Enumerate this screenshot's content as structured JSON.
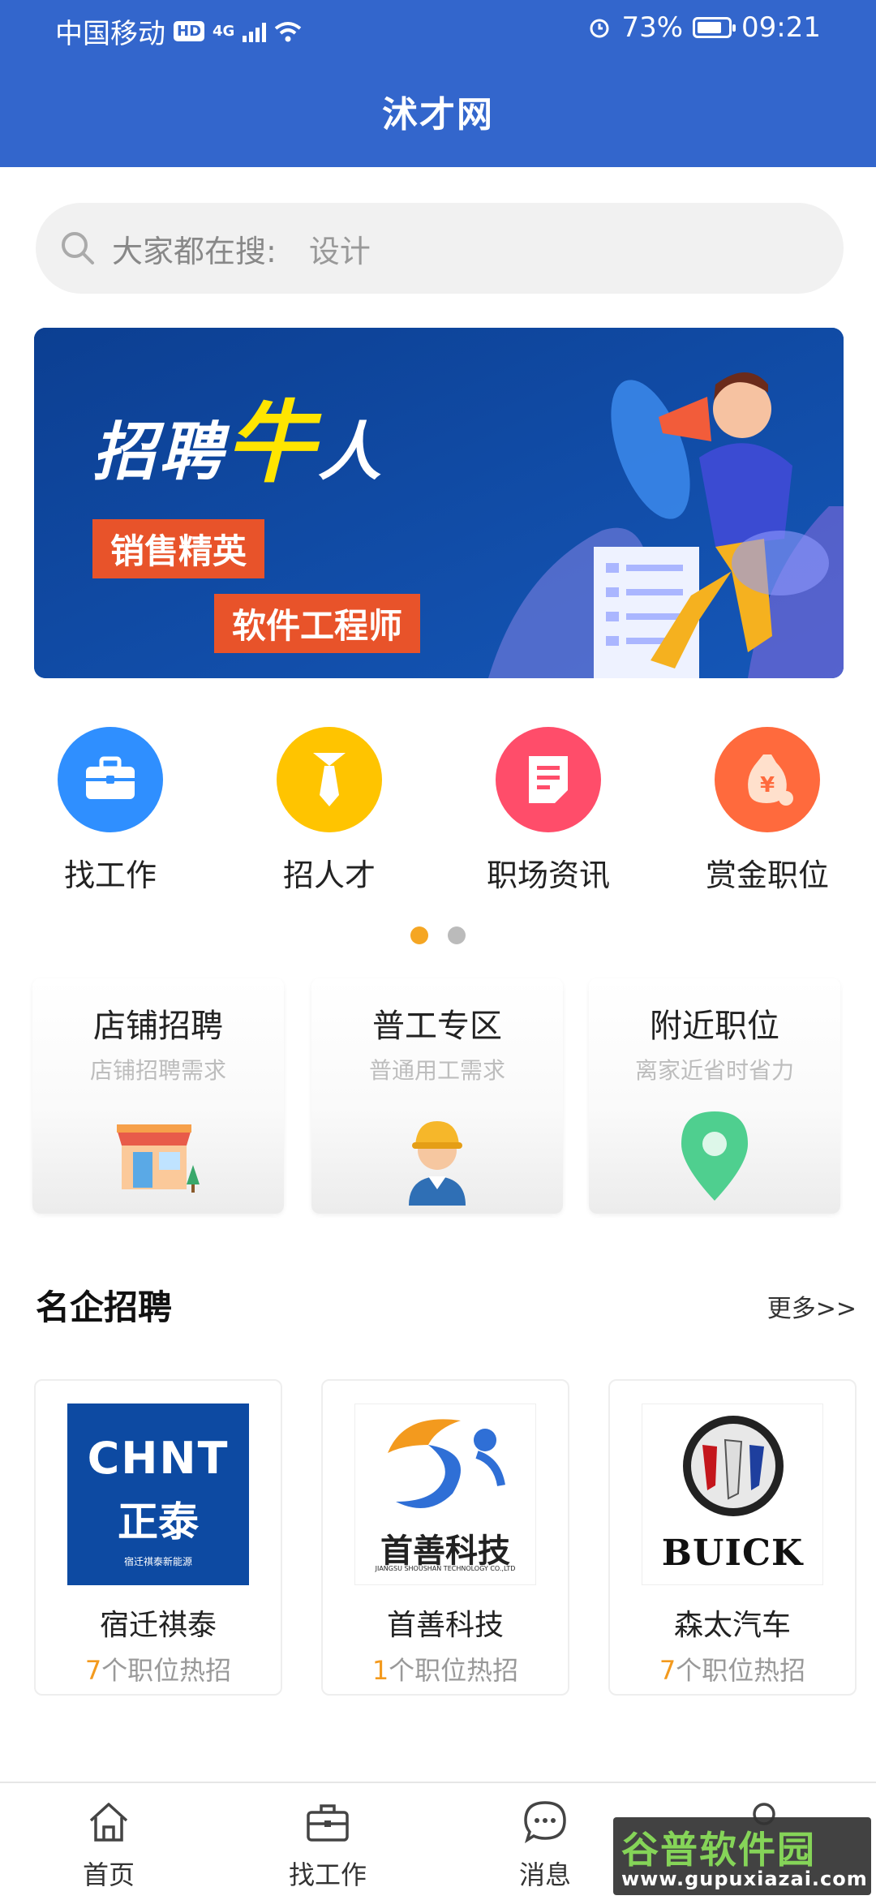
{
  "status_bar": {
    "carrier": "中国移动",
    "hd": "HD",
    "network": "4G",
    "battery_pct": "73%",
    "time": "09:21"
  },
  "header": {
    "title": "沭才网"
  },
  "search": {
    "placeholder": "大家都在搜:",
    "keyword": "设计"
  },
  "banner": {
    "headline_a": "招聘",
    "headline_b": "牛",
    "headline_c": "人",
    "tag1": "销售精英",
    "tag2": "软件工程师"
  },
  "quick_nav": [
    {
      "label": "找工作",
      "icon": "briefcase-icon",
      "color": "#2f8fff"
    },
    {
      "label": "招人才",
      "icon": "tie-icon",
      "color": "#ffc400"
    },
    {
      "label": "职场资讯",
      "icon": "news-icon",
      "color": "#ff4d6a"
    },
    {
      "label": "赏金职位",
      "icon": "money-bag-icon",
      "color": "#ff6a3d"
    }
  ],
  "pager": {
    "active_color": "#f5a623",
    "inactive_color": "#bbbbbb"
  },
  "zones": [
    {
      "title": "店铺招聘",
      "sub": "店铺招聘需求",
      "icon": "shop-icon"
    },
    {
      "title": "普工专区",
      "sub": "普通用工需求",
      "icon": "worker-icon"
    },
    {
      "title": "附近职位",
      "sub": "离家近省时省力",
      "icon": "location-pin-icon"
    }
  ],
  "famous": {
    "title": "名企招聘",
    "more": "更多>>"
  },
  "companies": [
    {
      "name": "宿迁祺泰",
      "count": "7",
      "suffix": "个职位热招",
      "logo_a": "CHNT",
      "logo_b": "正泰",
      "logo_c": "宿迁祺泰新能源"
    },
    {
      "name": "首善科技",
      "count": "1",
      "suffix": "个职位热招",
      "logo_a": "首善科技",
      "logo_b": "JIANGSU SHOUSHAN TECHNOLOGY CO.,LTD"
    },
    {
      "name": "森太汽车",
      "count": "7",
      "suffix": "个职位热招",
      "logo_a": "BUICK"
    }
  ],
  "tabbar": [
    {
      "label": "首页",
      "icon": "home-icon"
    },
    {
      "label": "找工作",
      "icon": "briefcase-icon"
    },
    {
      "label": "消息",
      "icon": "chat-icon"
    },
    {
      "label": "",
      "icon": "profile-icon"
    }
  ],
  "watermark": {
    "line1": "谷普软件园",
    "line2": "www.gupuxiazai.com"
  },
  "colors": {
    "primary": "#3366cc",
    "accent": "#f39a1e"
  }
}
